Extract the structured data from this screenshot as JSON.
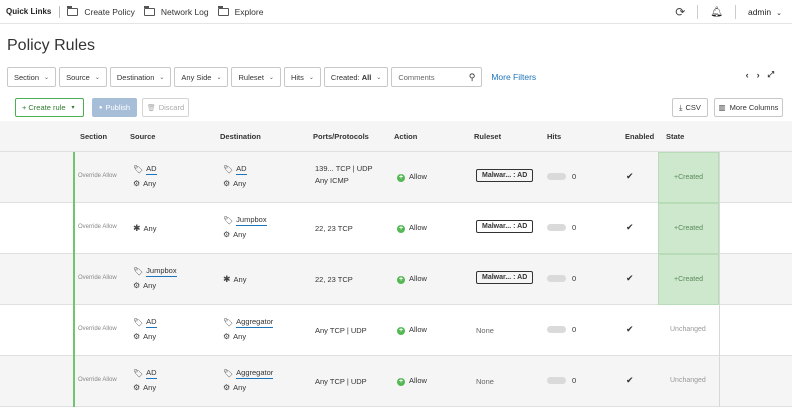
{
  "quick_links": {
    "title": "Quick Links",
    "items": [
      "Create Policy",
      "Network Log",
      "Explore"
    ]
  },
  "user": {
    "name": "admin"
  },
  "page_title": "Policy Rules",
  "filters": [
    {
      "label": "Section"
    },
    {
      "label": "Source"
    },
    {
      "label": "Destination"
    },
    {
      "label": "Any Side"
    },
    {
      "label": "Ruleset"
    },
    {
      "label": "Hits"
    },
    {
      "label": "Created:",
      "value": "All"
    }
  ],
  "comments_placeholder": "Comments",
  "more_filters": "More Filters",
  "pager": {
    "prev": "‹",
    "next": "›"
  },
  "actions": {
    "create_rule": "Create rule",
    "publish": "Publish",
    "discard": "Discard",
    "csv": "CSV",
    "more_columns": "More Columns"
  },
  "columns": [
    "Section",
    "Source",
    "Destination",
    "Ports/Protocols",
    "Action",
    "Ruleset",
    "Hits",
    "Enabled",
    "State"
  ],
  "rows": [
    {
      "section": "Override Allow",
      "source": [
        {
          "icon": "tag",
          "text": "AD",
          "underline": true
        },
        {
          "icon": "gear",
          "text": "Any"
        }
      ],
      "destination": [
        {
          "icon": "tag",
          "text": "AD",
          "underline": true
        },
        {
          "icon": "gear",
          "text": "Any"
        }
      ],
      "ports": [
        "139...  TCP | UDP",
        "Any  ICMP"
      ],
      "action": "Allow",
      "ruleset": "Malwar... : AD",
      "hits": "0",
      "enabled": "✔",
      "state": "Created"
    },
    {
      "section": "Override Allow",
      "source": [
        {
          "icon": "star",
          "text": "Any"
        }
      ],
      "destination": [
        {
          "icon": "tag",
          "text": "Jumpbox",
          "underline": true
        },
        {
          "icon": "gear",
          "text": "Any"
        }
      ],
      "ports": [
        "22, 23  TCP"
      ],
      "action": "Allow",
      "ruleset": "Malwar... : AD",
      "hits": "0",
      "enabled": "✔",
      "state": "Created"
    },
    {
      "section": "Override Allow",
      "source": [
        {
          "icon": "tag",
          "text": "Jumpbox",
          "underline": true
        },
        {
          "icon": "gear",
          "text": "Any"
        }
      ],
      "destination": [
        {
          "icon": "star",
          "text": "Any"
        }
      ],
      "ports": [
        "22, 23  TCP"
      ],
      "action": "Allow",
      "ruleset": "Malwar... : AD",
      "hits": "0",
      "enabled": "✔",
      "state": "Created"
    },
    {
      "section": "Override Allow",
      "source": [
        {
          "icon": "tag",
          "text": "AD",
          "underline": true
        },
        {
          "icon": "gear",
          "text": "Any"
        }
      ],
      "destination": [
        {
          "icon": "tag",
          "text": "Aggregator",
          "underline": true
        },
        {
          "icon": "gear",
          "text": "Any"
        }
      ],
      "ports": [
        "Any  TCP | UDP"
      ],
      "action": "Allow",
      "ruleset": "None",
      "hits": "0",
      "enabled": "✔",
      "state": "Unchanged"
    },
    {
      "section": "Override Allow",
      "source": [
        {
          "icon": "tag",
          "text": "AD",
          "underline": true
        },
        {
          "icon": "gear",
          "text": "Any"
        }
      ],
      "destination": [
        {
          "icon": "tag",
          "text": "Aggregator",
          "underline": true
        },
        {
          "icon": "gear",
          "text": "Any"
        }
      ],
      "ports": [
        "Any  TCP | UDP"
      ],
      "action": "Allow",
      "ruleset": "None",
      "hits": "0",
      "enabled": "✔",
      "state": "Unchanged"
    }
  ]
}
